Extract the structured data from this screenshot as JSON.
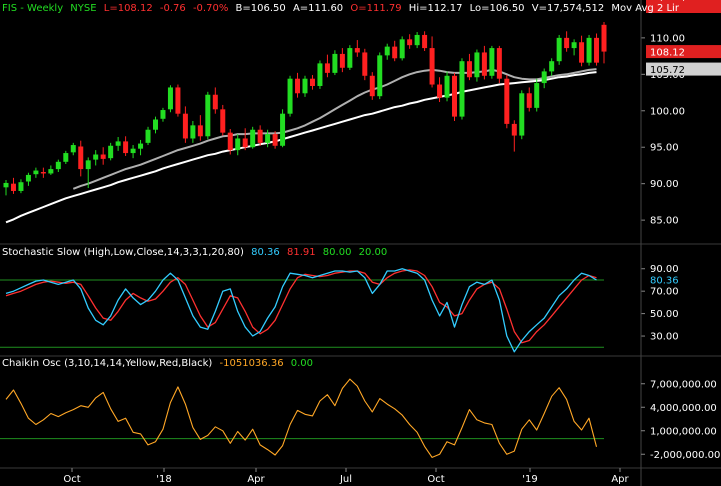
{
  "price_header": {
    "symbol": "FIS - Weekly",
    "exchange": "NYSE",
    "last": "L=108.12",
    "change": "-0.76",
    "change_pct": "-0.70%",
    "bid": "B=106.50",
    "ask": "A=111.60",
    "open": "O=111.79",
    "high": "Hi=112.17",
    "low": "Lo=106.50",
    "volume": "V=17,574,512",
    "study": "Mov Avg 2 Lir"
  },
  "stoch_header": {
    "label": "Stochastic Slow (High,Low,Close,14,3,3,1,20,80)",
    "k": "80.36",
    "d": "81.91",
    "upper": "80.00",
    "lower": "20.00"
  },
  "chaikin_header": {
    "label": "Chaikin Osc (3,10,14,14,Yellow,Red,Black)",
    "value": "-1051036.36",
    "zero": "0.00"
  },
  "colors": {
    "background": "#000000",
    "up_candle": "#22dd22",
    "down_candle": "#ff2020",
    "ma_short": "#b0b0b0",
    "ma_long": "#ffffff",
    "stoch_k": "#33ccff",
    "stoch_d": "#ff3030",
    "guide": "#1f8f1f",
    "chaikin": "#ffa726",
    "last_price_tag": "#e02020",
    "ma_tag": "#d0d0d0"
  },
  "chart_data": [
    {
      "type": "candlestick",
      "name": "price",
      "ylim": [
        82,
        113
      ],
      "y_ticks": [
        "110.00",
        "105.00",
        "100.00",
        "95.00",
        "90.00",
        "85.00"
      ],
      "x_labels": [
        "Oct",
        "'18",
        "Apr",
        "Jul",
        "Oct",
        "'19",
        "Apr"
      ],
      "last_price_tag": "108.12",
      "ma_price_tag": "105.72",
      "candles": [
        {
          "o": 89.5,
          "h": 90.5,
          "l": 88.4,
          "c": 90.1
        },
        {
          "o": 90.0,
          "h": 90.8,
          "l": 88.6,
          "c": 89.0
        },
        {
          "o": 89.0,
          "h": 90.6,
          "l": 88.7,
          "c": 90.2
        },
        {
          "o": 90.3,
          "h": 91.5,
          "l": 89.7,
          "c": 91.2
        },
        {
          "o": 91.3,
          "h": 92.2,
          "l": 90.8,
          "c": 91.8
        },
        {
          "o": 91.6,
          "h": 92.2,
          "l": 90.8,
          "c": 91.4
        },
        {
          "o": 91.4,
          "h": 92.5,
          "l": 91.2,
          "c": 92.0
        },
        {
          "o": 92.0,
          "h": 93.3,
          "l": 91.6,
          "c": 93.0
        },
        {
          "o": 93.0,
          "h": 94.5,
          "l": 92.7,
          "c": 94.2
        },
        {
          "o": 94.3,
          "h": 95.6,
          "l": 93.9,
          "c": 95.3
        },
        {
          "o": 95.1,
          "h": 95.9,
          "l": 91.0,
          "c": 92.0
        },
        {
          "o": 92.0,
          "h": 93.6,
          "l": 89.4,
          "c": 93.2
        },
        {
          "o": 93.3,
          "h": 94.6,
          "l": 92.5,
          "c": 94.0
        },
        {
          "o": 94.0,
          "h": 95.0,
          "l": 92.6,
          "c": 93.4
        },
        {
          "o": 93.5,
          "h": 95.6,
          "l": 93.2,
          "c": 95.2
        },
        {
          "o": 95.2,
          "h": 96.4,
          "l": 94.5,
          "c": 95.8
        },
        {
          "o": 95.8,
          "h": 96.5,
          "l": 93.8,
          "c": 94.2
        },
        {
          "o": 94.2,
          "h": 95.3,
          "l": 93.5,
          "c": 94.8
        },
        {
          "o": 94.8,
          "h": 96.0,
          "l": 93.9,
          "c": 95.5
        },
        {
          "o": 95.6,
          "h": 97.8,
          "l": 95.3,
          "c": 97.4
        },
        {
          "o": 97.4,
          "h": 99.2,
          "l": 96.9,
          "c": 98.8
        },
        {
          "o": 98.9,
          "h": 100.4,
          "l": 98.5,
          "c": 100.1
        },
        {
          "o": 100.2,
          "h": 103.5,
          "l": 99.8,
          "c": 103.2
        },
        {
          "o": 103.2,
          "h": 103.6,
          "l": 99.2,
          "c": 99.6
        },
        {
          "o": 99.6,
          "h": 100.6,
          "l": 95.6,
          "c": 96.2
        },
        {
          "o": 96.2,
          "h": 98.6,
          "l": 95.6,
          "c": 98.0
        },
        {
          "o": 98.0,
          "h": 99.4,
          "l": 95.9,
          "c": 96.5
        },
        {
          "o": 96.5,
          "h": 102.6,
          "l": 96.1,
          "c": 102.2
        },
        {
          "o": 102.2,
          "h": 103.2,
          "l": 99.6,
          "c": 100.2
        },
        {
          "o": 100.2,
          "h": 100.8,
          "l": 96.6,
          "c": 97.0
        },
        {
          "o": 97.0,
          "h": 97.5,
          "l": 94.0,
          "c": 94.6
        },
        {
          "o": 94.6,
          "h": 96.8,
          "l": 93.9,
          "c": 96.2
        },
        {
          "o": 96.2,
          "h": 97.6,
          "l": 94.6,
          "c": 95.0
        },
        {
          "o": 95.0,
          "h": 97.8,
          "l": 94.8,
          "c": 97.4
        },
        {
          "o": 97.4,
          "h": 98.0,
          "l": 95.2,
          "c": 95.6
        },
        {
          "o": 95.6,
          "h": 97.4,
          "l": 95.0,
          "c": 96.8
        },
        {
          "o": 96.8,
          "h": 97.2,
          "l": 94.8,
          "c": 95.2
        },
        {
          "o": 95.2,
          "h": 100.2,
          "l": 95.0,
          "c": 99.6
        },
        {
          "o": 99.6,
          "h": 104.8,
          "l": 99.2,
          "c": 104.4
        },
        {
          "o": 104.4,
          "h": 105.2,
          "l": 101.8,
          "c": 102.4
        },
        {
          "o": 102.4,
          "h": 104.8,
          "l": 101.9,
          "c": 104.4
        },
        {
          "o": 104.4,
          "h": 104.9,
          "l": 102.9,
          "c": 103.4
        },
        {
          "o": 103.4,
          "h": 106.9,
          "l": 103.0,
          "c": 106.5
        },
        {
          "o": 106.5,
          "h": 107.7,
          "l": 104.6,
          "c": 105.2
        },
        {
          "o": 105.2,
          "h": 108.3,
          "l": 104.9,
          "c": 107.8
        },
        {
          "o": 107.8,
          "h": 108.6,
          "l": 105.3,
          "c": 105.9
        },
        {
          "o": 105.9,
          "h": 109.0,
          "l": 105.6,
          "c": 108.6
        },
        {
          "o": 108.6,
          "h": 109.7,
          "l": 107.4,
          "c": 108.0
        },
        {
          "o": 108.0,
          "h": 108.5,
          "l": 104.2,
          "c": 104.8
        },
        {
          "o": 104.8,
          "h": 105.3,
          "l": 101.5,
          "c": 102.0
        },
        {
          "o": 102.0,
          "h": 108.0,
          "l": 101.6,
          "c": 107.6
        },
        {
          "o": 107.6,
          "h": 109.2,
          "l": 107.0,
          "c": 108.8
        },
        {
          "o": 108.8,
          "h": 109.6,
          "l": 106.8,
          "c": 107.2
        },
        {
          "o": 107.2,
          "h": 110.2,
          "l": 106.9,
          "c": 109.8
        },
        {
          "o": 109.8,
          "h": 110.5,
          "l": 108.5,
          "c": 109.0
        },
        {
          "o": 109.0,
          "h": 110.8,
          "l": 108.6,
          "c": 110.4
        },
        {
          "o": 110.4,
          "h": 110.9,
          "l": 108.2,
          "c": 108.6
        },
        {
          "o": 108.6,
          "h": 110.2,
          "l": 103.2,
          "c": 103.6
        },
        {
          "o": 103.6,
          "h": 104.6,
          "l": 101.2,
          "c": 101.8
        },
        {
          "o": 101.8,
          "h": 105.4,
          "l": 101.3,
          "c": 104.8
        },
        {
          "o": 104.8,
          "h": 105.2,
          "l": 98.6,
          "c": 99.2
        },
        {
          "o": 99.2,
          "h": 107.2,
          "l": 98.8,
          "c": 106.8
        },
        {
          "o": 106.8,
          "h": 107.8,
          "l": 104.2,
          "c": 104.6
        },
        {
          "o": 104.6,
          "h": 108.4,
          "l": 104.0,
          "c": 108.0
        },
        {
          "o": 108.0,
          "h": 108.9,
          "l": 104.3,
          "c": 104.8
        },
        {
          "o": 104.8,
          "h": 108.9,
          "l": 104.4,
          "c": 108.6
        },
        {
          "o": 108.6,
          "h": 108.9,
          "l": 103.8,
          "c": 104.4
        },
        {
          "o": 104.4,
          "h": 104.9,
          "l": 97.6,
          "c": 98.2
        },
        {
          "o": 98.2,
          "h": 98.7,
          "l": 94.4,
          "c": 96.6
        },
        {
          "o": 96.6,
          "h": 102.8,
          "l": 96.1,
          "c": 102.4
        },
        {
          "o": 102.4,
          "h": 103.2,
          "l": 99.9,
          "c": 100.4
        },
        {
          "o": 100.4,
          "h": 104.4,
          "l": 99.9,
          "c": 103.8
        },
        {
          "o": 103.8,
          "h": 105.8,
          "l": 103.1,
          "c": 105.4
        },
        {
          "o": 105.4,
          "h": 107.2,
          "l": 104.8,
          "c": 106.8
        },
        {
          "o": 106.8,
          "h": 110.4,
          "l": 106.3,
          "c": 110.0
        },
        {
          "o": 110.0,
          "h": 110.9,
          "l": 108.1,
          "c": 108.6
        },
        {
          "o": 108.6,
          "h": 109.8,
          "l": 107.6,
          "c": 109.4
        },
        {
          "o": 109.4,
          "h": 110.3,
          "l": 106.1,
          "c": 106.6
        },
        {
          "o": 106.6,
          "h": 110.4,
          "l": 106.2,
          "c": 110.0
        },
        {
          "o": 110.0,
          "h": 110.6,
          "l": 106.2,
          "c": 106.6
        },
        {
          "o": 111.79,
          "h": 112.17,
          "l": 106.5,
          "c": 108.12
        }
      ],
      "series": [
        {
          "role": "short moving average",
          "values": [
            null,
            null,
            null,
            null,
            null,
            null,
            null,
            null,
            null,
            89.3,
            89.7,
            90.0,
            90.4,
            90.8,
            91.2,
            91.6,
            92.0,
            92.3,
            92.6,
            93.0,
            93.4,
            93.8,
            94.2,
            94.6,
            94.9,
            95.2,
            95.5,
            95.9,
            96.2,
            96.5,
            96.6,
            96.8,
            96.8,
            96.9,
            96.9,
            96.9,
            96.9,
            97.0,
            97.3,
            97.6,
            98.0,
            98.5,
            99.0,
            99.6,
            100.2,
            100.8,
            101.4,
            102.0,
            102.5,
            102.9,
            103.2,
            103.6,
            104.1,
            104.6,
            105.0,
            105.3,
            105.5,
            105.6,
            105.5,
            105.3,
            105.2,
            105.2,
            105.2,
            105.3,
            105.4,
            105.6,
            105.4,
            105.0,
            104.6,
            104.4,
            104.3,
            104.3,
            104.5,
            104.7,
            104.9,
            105.0,
            105.2,
            105.4,
            105.6,
            105.72
          ]
        },
        {
          "role": "long moving average",
          "values": [
            84.7,
            85.1,
            85.6,
            86.0,
            86.4,
            86.8,
            87.2,
            87.6,
            88.0,
            88.3,
            88.6,
            88.9,
            89.2,
            89.5,
            89.8,
            90.2,
            90.5,
            90.8,
            91.1,
            91.4,
            91.7,
            92.1,
            92.4,
            92.7,
            93.0,
            93.3,
            93.6,
            93.9,
            94.1,
            94.4,
            94.6,
            94.8,
            95.0,
            95.2,
            95.4,
            95.6,
            95.8,
            96.1,
            96.4,
            96.7,
            97.0,
            97.3,
            97.6,
            97.9,
            98.2,
            98.5,
            98.8,
            99.1,
            99.4,
            99.6,
            99.9,
            100.2,
            100.5,
            100.7,
            101.0,
            101.2,
            101.5,
            101.7,
            101.9,
            102.1,
            102.3,
            102.6,
            102.8,
            103.0,
            103.2,
            103.4,
            103.6,
            103.7,
            103.8,
            103.9,
            104.0,
            104.1,
            104.2,
            104.4,
            104.6,
            104.7,
            104.9,
            105.0,
            105.2,
            105.3
          ]
        }
      ]
    },
    {
      "type": "line",
      "name": "stochastic",
      "ylim": [
        14,
        96
      ],
      "y_ticks": [
        "90.00",
        "70.00",
        "50.00",
        "30.00"
      ],
      "last_tag": "80.36",
      "guides": [
        80,
        20
      ],
      "series": [
        {
          "role": "%K",
          "values": [
            68,
            70,
            73,
            76,
            79,
            80,
            78,
            76,
            78,
            80,
            72,
            55,
            44,
            40,
            48,
            62,
            72,
            64,
            58,
            62,
            70,
            80,
            86,
            80,
            64,
            48,
            38,
            36,
            52,
            70,
            72,
            52,
            38,
            30,
            34,
            46,
            56,
            74,
            86,
            85,
            84,
            82,
            84,
            86,
            88,
            88,
            87,
            88,
            82,
            68,
            76,
            88,
            88,
            90,
            88,
            86,
            80,
            62,
            48,
            60,
            38,
            58,
            74,
            78,
            76,
            80,
            62,
            30,
            16,
            26,
            34,
            40,
            46,
            56,
            66,
            72,
            80,
            86,
            84,
            80
          ]
        },
        {
          "role": "%D",
          "values": [
            66,
            68,
            70,
            73,
            76,
            78,
            79,
            78,
            77,
            78,
            76,
            66,
            55,
            46,
            44,
            52,
            62,
            68,
            64,
            61,
            63,
            70,
            78,
            82,
            76,
            62,
            48,
            38,
            42,
            54,
            66,
            64,
            52,
            38,
            32,
            36,
            44,
            58,
            72,
            82,
            85,
            84,
            83,
            84,
            86,
            87,
            88,
            88,
            86,
            78,
            76,
            82,
            86,
            88,
            89,
            88,
            84,
            74,
            60,
            56,
            48,
            50,
            62,
            72,
            76,
            78,
            72,
            54,
            34,
            24,
            26,
            34,
            40,
            48,
            56,
            64,
            72,
            80,
            84,
            82
          ]
        }
      ]
    },
    {
      "type": "line",
      "name": "chaikin oscillator",
      "ylim": [
        -3500000,
        8500000
      ],
      "y_ticks": [
        "7,000,000.00",
        "4,000,000.00",
        "1,000,000.00",
        "-2,000,000.00"
      ],
      "last_tag": "-1,051,036.36",
      "guides": [
        0
      ],
      "series": [
        {
          "role": "oscillator",
          "values": [
            5000000,
            6200000,
            4500000,
            2600000,
            1800000,
            2400000,
            3200000,
            2800000,
            3300000,
            3700000,
            4200000,
            4000000,
            5200000,
            5900000,
            3800000,
            2200000,
            2600000,
            800000,
            600000,
            -800000,
            -400000,
            1200000,
            4600000,
            6600000,
            4400000,
            1400000,
            -100000,
            400000,
            1500000,
            1000000,
            -600000,
            900000,
            -200000,
            1200000,
            -800000,
            -1400000,
            -2100000,
            -900000,
            1800000,
            3600000,
            3100000,
            2900000,
            4800000,
            5600000,
            4200000,
            6400000,
            7600000,
            6700000,
            4800000,
            3400000,
            5100000,
            4400000,
            3800000,
            3000000,
            1800000,
            800000,
            -1000000,
            -2400000,
            -2000000,
            -400000,
            -800000,
            1400000,
            3700000,
            2400000,
            2000000,
            1800000,
            -600000,
            -2000000,
            -1600000,
            1200000,
            2400000,
            1100000,
            3200000,
            5400000,
            6500000,
            5000000,
            2200000,
            1100000,
            2600000,
            -1051036.36
          ]
        }
      ]
    }
  ]
}
